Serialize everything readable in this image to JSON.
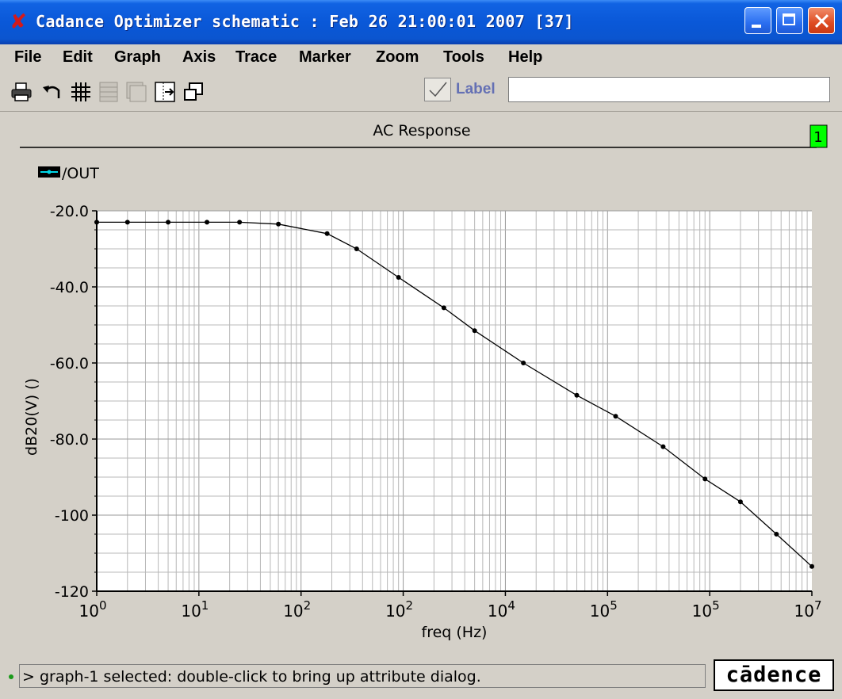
{
  "window": {
    "title": "Cadance Optimizer schematic : Feb 26 21:00:01 2007 [37]",
    "icon": "close-x-icon"
  },
  "menu": [
    "File",
    "Edit",
    "Graph",
    "Axis",
    "Trace",
    "Marker",
    "Zoom",
    "Tools",
    "Help"
  ],
  "toolbar": {
    "icons": [
      "print-icon",
      "undo-icon",
      "grid-icon",
      "strip-icon",
      "stack-icon",
      "split-icon",
      "window-icon"
    ],
    "label_checkbox_label": "Label",
    "label_value": ""
  },
  "colors": {
    "trace": "#000000",
    "legend_swatch": "#000000",
    "legend_marker": "#00d8e8",
    "subwindow_badge": "#00ff00"
  },
  "graph": {
    "subwindow_number": "1",
    "legend": "/OUT"
  },
  "chart_data": {
    "type": "line",
    "title": "AC Response",
    "xlabel": "freq (Hz)",
    "ylabel": "dB20(V)  ()",
    "x_scale": "log",
    "xlim": [
      1,
      10000000
    ],
    "ylim": [
      -120,
      -20
    ],
    "x_tick_labels": [
      {
        "base": "10",
        "exp": "0"
      },
      {
        "base": "10",
        "exp": "1"
      },
      {
        "base": "10",
        "exp": "2"
      },
      {
        "base": "10",
        "exp": "2"
      },
      {
        "base": "10",
        "exp": "4"
      },
      {
        "base": "10",
        "exp": "5"
      },
      {
        "base": "10",
        "exp": "5"
      },
      {
        "base": "10",
        "exp": "7"
      }
    ],
    "y_tick_labels": [
      "-20.0",
      "-40.0",
      "-60.0",
      "-80.0",
      "-100",
      "-120"
    ],
    "grid": true,
    "series": [
      {
        "name": "/OUT",
        "marker": "dot",
        "x": [
          1,
          2,
          5,
          12,
          25,
          60,
          180,
          350,
          900,
          2500,
          5000,
          15000,
          50000,
          120000,
          350000,
          900000,
          2000000,
          4500000,
          10000000
        ],
        "y": [
          -23,
          -23,
          -23,
          -23,
          -23,
          -23.5,
          -26,
          -30,
          -37.5,
          -45.5,
          -51.5,
          -60,
          -68.5,
          -74,
          -82,
          -90.5,
          -96.5,
          -105,
          -113.5
        ]
      }
    ]
  },
  "status": {
    "message": "> graph-1 selected: double-click to bring up attribute dialog.",
    "logo": "cādence"
  }
}
